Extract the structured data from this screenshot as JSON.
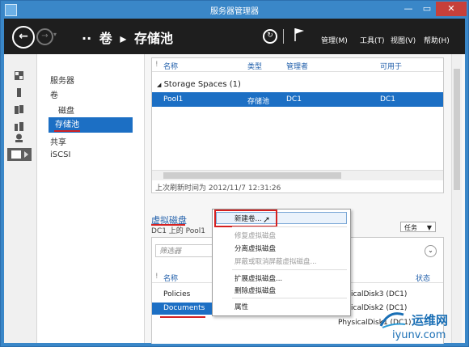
{
  "window": {
    "title": "服务器管理器",
    "min": "—",
    "max": "▭",
    "close": "✕"
  },
  "nav": {
    "back": "←",
    "forward": "→",
    "dropdown": "▾",
    "breadcrumb": {
      "prefix": "··",
      "seg1": "卷",
      "sep": "▸",
      "seg2": "存储池"
    },
    "refresh": "↻",
    "menus": {
      "manage": "管理(M)",
      "tools": "工具(T)",
      "view": "视图(V)",
      "help": "帮助(H)"
    }
  },
  "tree": {
    "items": [
      "服务器",
      "卷",
      "磁盘",
      "存储池",
      "共享",
      "iSCSI"
    ],
    "selected": "存储池"
  },
  "pools": {
    "columns": [
      "名称",
      "类型",
      "管理者",
      "可用于"
    ],
    "group": "Storage Spaces (1)",
    "row": {
      "name": "Pool1",
      "type": "存储池",
      "managed_by": "DC1",
      "available_to": "DC1"
    },
    "last_refresh": "上次刷新时间为 2012/11/7 12:31:26"
  },
  "vdisks": {
    "title": "虚拟磁盘",
    "subtitle": "DC1 上的 Pool1",
    "tasks_label": "任务",
    "filter_placeholder": "筛选器",
    "columns": [
      "名称",
      "状态"
    ],
    "rows": [
      {
        "name": "Policies",
        "disk": "icalDisk3 (DC1)"
      },
      {
        "name": "Documents",
        "disk": "icalDisk2 (DC1)"
      },
      {
        "name": "",
        "disk": "PhysicalDisk1 (DC1)"
      }
    ]
  },
  "context_menu": {
    "items": [
      {
        "label": "新建卷...",
        "disabled": false
      },
      {
        "label": "修复虚拟磁盘",
        "disabled": true
      },
      {
        "label": "分离虚拟磁盘",
        "disabled": false
      },
      {
        "label": "屏蔽或取消屏蔽虚拟磁盘...",
        "disabled": true
      },
      {
        "label": "扩展虚拟磁盘...",
        "disabled": false
      },
      {
        "label": "删除虚拟磁盘",
        "disabled": false
      },
      {
        "label": "属性",
        "disabled": false
      }
    ]
  },
  "watermark": {
    "line1": "运维网",
    "line2": "iyunv.com"
  }
}
